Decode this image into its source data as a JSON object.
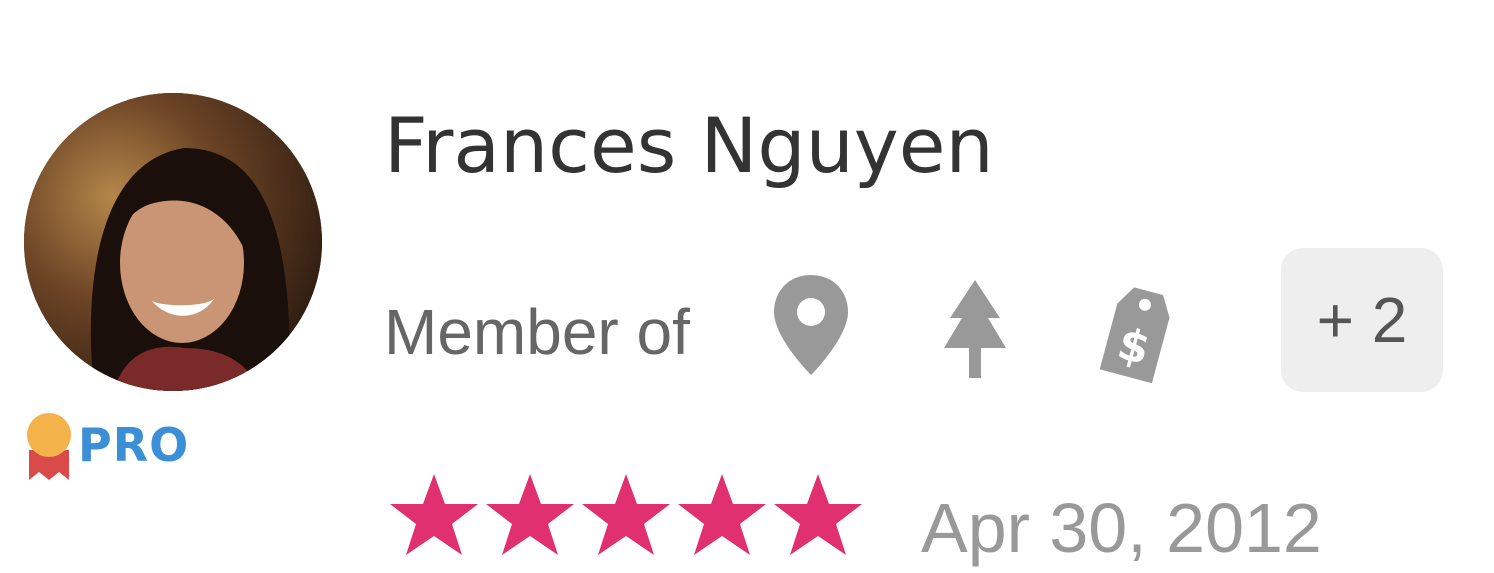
{
  "user": {
    "name": "Frances Nguyen",
    "badge": "PRO"
  },
  "membership": {
    "label": "Member of",
    "groups": [
      {
        "icon": "location-pin-icon"
      },
      {
        "icon": "tree-icon"
      },
      {
        "icon": "price-tag-icon"
      }
    ],
    "more_label": "+ 2"
  },
  "review": {
    "rating": 5,
    "max_rating": 5,
    "date": "Apr 30, 2012"
  },
  "colors": {
    "star": "#e0306f",
    "icon": "#999999",
    "pro": "#3b8fd6",
    "name": "#333333"
  }
}
